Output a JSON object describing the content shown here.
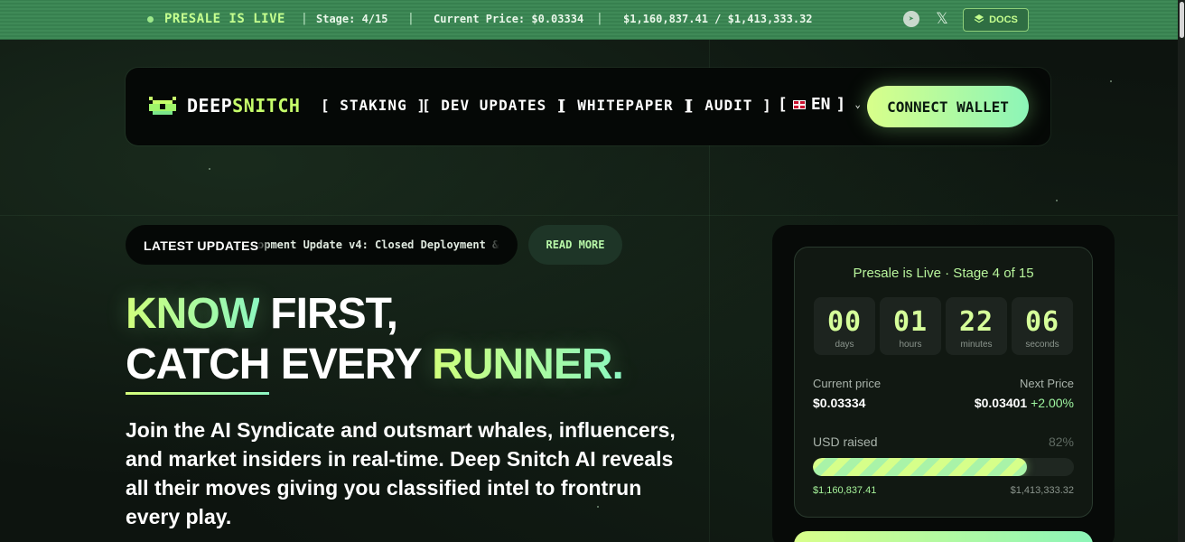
{
  "ticker": {
    "live_label": "PRESALE IS LIVE",
    "stage": "Stage: 4/15",
    "price": "Current Price: $0.03334",
    "raised": "$1,160,837.41 / $1,413,333.32",
    "docs_label": "DOCS",
    "social_icons": [
      "telegram-icon",
      "x-icon"
    ]
  },
  "nav": {
    "logo_part1": "DEEP",
    "logo_part2": "SNITCH",
    "links": [
      "[ STAKING ]",
      "[ DEV UPDATES ]",
      "[ WHITEPAPER ]",
      "[ AUDIT ]"
    ],
    "lang_open": "[",
    "lang_code": "EN",
    "lang_close": "]",
    "connect_label": "CONNECT WALLET"
  },
  "updates": {
    "label": "LATEST UPDATES",
    "text": "opment Update v4: Closed Deployment &",
    "read_more": "READ MORE"
  },
  "hero": {
    "line1_accent": "KNOW",
    "line1_rest": " FIRST,",
    "line2_a": "CATCH",
    "line2_b": " EVERY ",
    "line2_accent": "RUNNER.",
    "subtitle": "Join the AI Syndicate and outsmart whales, influencers, and market insiders in real-time. Deep Snitch AI reveals all their moves giving you classified intel to frontrun every play."
  },
  "presale": {
    "title": "Presale is Live · Stage 4 of 15",
    "countdown": [
      {
        "value": "00",
        "unit": "days"
      },
      {
        "value": "01",
        "unit": "hours"
      },
      {
        "value": "22",
        "unit": "minutes"
      },
      {
        "value": "06",
        "unit": "seconds"
      }
    ],
    "current_price_label": "Current price",
    "current_price": "$0.03334",
    "next_price_label": "Next Price",
    "next_price": "$0.03401",
    "next_price_change": "+2.00%",
    "usd_raised_label": "USD raised",
    "raised_percent_text": "82%",
    "raised_fraction": 0.82,
    "raised_amount": "$1,160,837.41",
    "raised_target": "$1,413,333.32"
  },
  "colors": {
    "accent": "#c6ff6a",
    "accent2": "#8cf5b8",
    "ticker_bg": "#3f8a57",
    "page_bg": "#0d140f"
  }
}
